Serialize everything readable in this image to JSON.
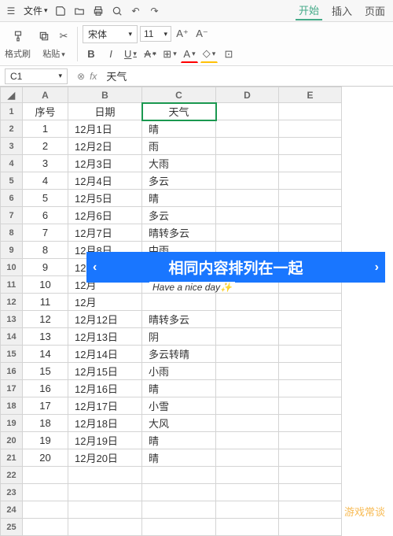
{
  "menu": {
    "file": "文件",
    "tabs": {
      "start": "开始",
      "insert": "插入",
      "page": "页面"
    }
  },
  "ribbon": {
    "fmt": "格式刷",
    "paste": "粘贴",
    "font": "宋体",
    "size": "11"
  },
  "fx": {
    "cell": "C1",
    "value": "天气"
  },
  "cols": [
    "A",
    "B",
    "C",
    "D",
    "E"
  ],
  "headers": {
    "a": "序号",
    "b": "日期",
    "c": "天气"
  },
  "rows": [
    {
      "n": "1",
      "d": "12月1日",
      "w": "晴"
    },
    {
      "n": "2",
      "d": "12月2日",
      "w": "雨"
    },
    {
      "n": "3",
      "d": "12月3日",
      "w": "大雨"
    },
    {
      "n": "4",
      "d": "12月4日",
      "w": "多云"
    },
    {
      "n": "5",
      "d": "12月5日",
      "w": "晴"
    },
    {
      "n": "6",
      "d": "12月6日",
      "w": "多云"
    },
    {
      "n": "7",
      "d": "12月7日",
      "w": "晴转多云"
    },
    {
      "n": "8",
      "d": "12月8日",
      "w": "中雨"
    },
    {
      "n": "9",
      "d": "12月",
      "w": ""
    },
    {
      "n": "10",
      "d": "12月",
      "w": ""
    },
    {
      "n": "11",
      "d": "12月",
      "w": ""
    },
    {
      "n": "12",
      "d": "12月12日",
      "w": "晴转多云"
    },
    {
      "n": "13",
      "d": "12月13日",
      "w": "阴"
    },
    {
      "n": "14",
      "d": "12月14日",
      "w": "多云转晴"
    },
    {
      "n": "15",
      "d": "12月15日",
      "w": "小雨"
    },
    {
      "n": "16",
      "d": "12月16日",
      "w": "晴"
    },
    {
      "n": "17",
      "d": "12月17日",
      "w": "小雪"
    },
    {
      "n": "18",
      "d": "12月18日",
      "w": "大风"
    },
    {
      "n": "19",
      "d": "12月19日",
      "w": "晴"
    },
    {
      "n": "20",
      "d": "12月20日",
      "w": "晴"
    }
  ],
  "banner": {
    "text": "相同内容排列在一起",
    "sub": "Have a nice day✨"
  },
  "watermark": "游戏常谈"
}
